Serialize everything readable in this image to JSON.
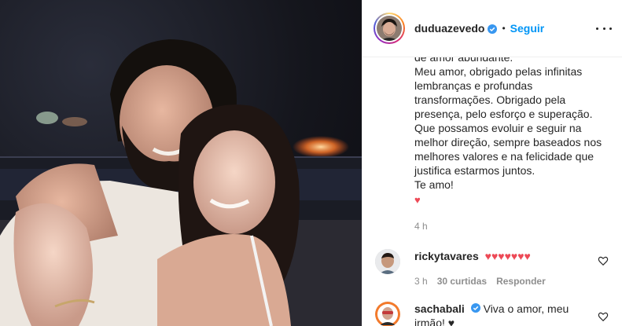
{
  "post": {
    "username": "duduazevedo",
    "separator": "•",
    "follow_label": "Seguir",
    "caption_lines": "de amor abundante.\nMeu amor, obrigado pelas infinitas lembranças e profundas transformações. Obrigado pela presença, pelo esforço e superação. Que possamos evoluir e seguir na melhor direção, sempre baseados nos melhores valores e na felicidade que justifica estarmos juntos.\nTe amo!",
    "caption_emoji": "♥",
    "timestamp": "4 h"
  },
  "comments": [
    {
      "username": "rickytavares",
      "text": "",
      "hearts": "♥♥♥♥♥♥♥",
      "time": "3 h",
      "likes": "30 curtidas",
      "reply_label": "Responder"
    },
    {
      "username": "sachabali",
      "text": "Viva o amor, meu irmão! ♥",
      "hearts": "",
      "time": "",
      "likes": "",
      "reply_label": ""
    }
  ],
  "colors": {
    "link_blue": "#0095f6",
    "verified_blue": "#3897f0",
    "heart_red": "#ed4956",
    "meta_gray": "#8e8e8e"
  },
  "icons": {
    "verified": "verified-badge-icon",
    "more": "more-options-icon",
    "like": "heart-outline-icon"
  }
}
